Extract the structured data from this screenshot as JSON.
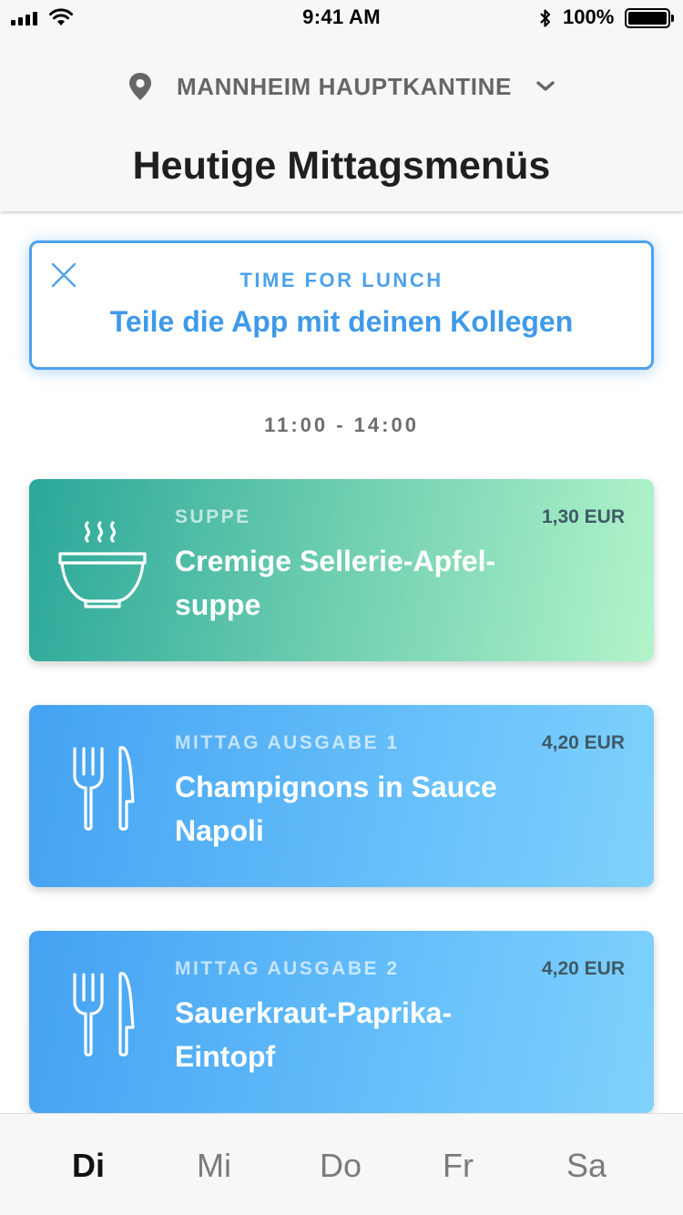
{
  "status_bar": {
    "time": "9:41 AM",
    "battery": "100%"
  },
  "location": {
    "name": "MANNHEIM HAUPTKANTINE",
    "pin_icon": "location-pin-icon",
    "dropdown_icon": "chevron-down-icon"
  },
  "page_title": "Heutige Mittagsmenüs",
  "promo": {
    "kicker": "TIME FOR LUNCH",
    "text": "Teile die App mit deinen Kollegen",
    "close_icon": "close-icon"
  },
  "hours": "11:00 - 14:00",
  "menu": [
    {
      "category": "SUPPE",
      "price": "1,30 EUR",
      "title": "Cremige Sellerie-Apfel-suppe",
      "icon": "soup-bowl-icon"
    },
    {
      "category": "MITTAG AUSGABE 1",
      "price": "4,20 EUR",
      "title": "Champignons in Sauce Napoli",
      "icon": "fork-knife-icon"
    },
    {
      "category": "MITTAG AUSGABE 2",
      "price": "4,20 EUR",
      "title": "Sauerkraut-Paprika-Eintopf",
      "icon": "fork-knife-icon"
    }
  ],
  "days": [
    {
      "label": "Di",
      "active": true
    },
    {
      "label": "Mi",
      "active": false
    },
    {
      "label": "Do",
      "active": false
    },
    {
      "label": "Fr",
      "active": false
    },
    {
      "label": "Sa",
      "active": false
    }
  ],
  "colors": {
    "accent": "#4ea2ec",
    "soup_gradient": [
      "#2aa79a",
      "#b3f4cb"
    ],
    "main_gradient": [
      "#45a2f2",
      "#7fd2fd"
    ],
    "price_text": "#3f5a66"
  }
}
